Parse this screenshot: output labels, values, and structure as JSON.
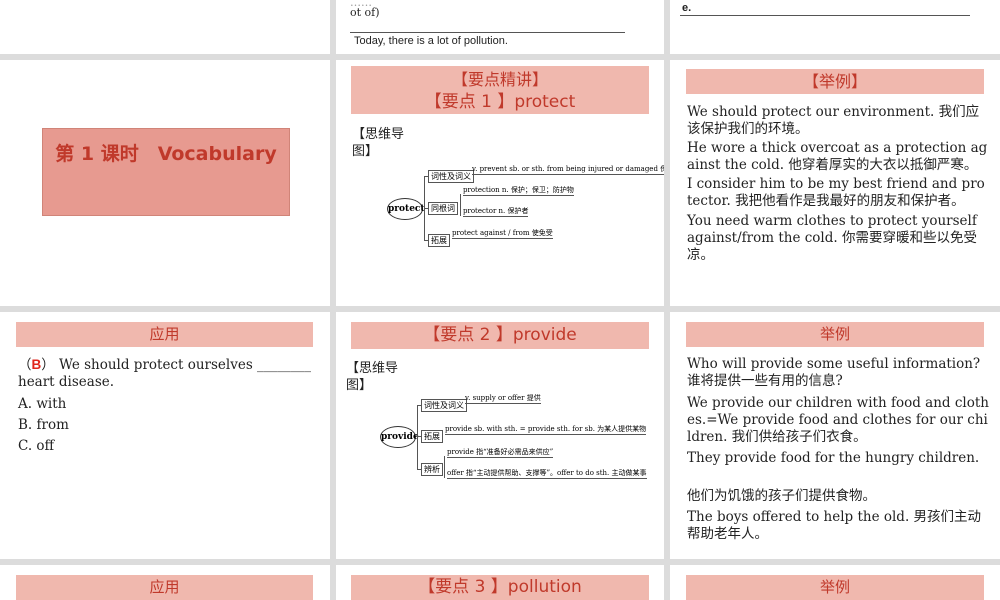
{
  "top": {
    "mid_partial": "ot of)",
    "mid_partial_prefix": "……",
    "mid_answer": "Today, there is a lot of pollution.",
    "right_partial": "e."
  },
  "slide1": {
    "title": "第 1 课时　Vocabulary"
  },
  "slide2": {
    "header1": "【要点精讲】",
    "header2": "【要点 1 】protect",
    "mindmap_label": "【思维导图】",
    "center": "protect",
    "branches": [
      {
        "tag": "词性及词义",
        "text": "v. prevent sb. or sth. from being injured or damaged 保护"
      },
      {
        "tag": "同根词",
        "text": "protection n. 保护；保卫；防护物"
      },
      {
        "tag": "",
        "text": "protector n. 保护者"
      },
      {
        "tag": "拓展",
        "text": "protect against / from 使免受"
      }
    ]
  },
  "slide3": {
    "header": "【举例】",
    "examples": [
      "We should protect our environment. 我们应该保护我们的环境。",
      "He wore a thick overcoat as a protection against the cold. 他穿着厚实的大衣以抵御严寒。",
      "I consider him to be my best friend and protector. 我把他看作是我最好的朋友和保护者。",
      "You need warm clothes to protect yourself against/from the cold. 你需要穿暖和些以免受凉。"
    ]
  },
  "slide4": {
    "header": "应用",
    "answer": "B",
    "question": "We should protect ourselves ________ heart disease.",
    "options": [
      "A. with",
      "B. from",
      "C. off"
    ]
  },
  "slide5": {
    "header": "【要点 2 】provide",
    "mindmap_label": "【思维导图】",
    "center": "provide",
    "branches": [
      {
        "tag": "词性及词义",
        "text": "v. supply or offer 提供"
      },
      {
        "tag": "拓展",
        "text": "provide sb. with sth. = provide sth. for sb. 为某人提供某物"
      },
      {
        "tag": "辨析",
        "text": "provide 指“准备好必需品来供应”"
      },
      {
        "tag": "",
        "text": "offer 指“主动提供帮助、支撑等”。offer to do sth. 主动做某事"
      }
    ]
  },
  "slide6": {
    "header": "举例",
    "examples": [
      "Who will provide some useful information? 谁将提供一些有用的信息?",
      "We provide our children with food and clothes.=We provide food and clothes for our children. 我们供给孩子们衣食。",
      "They provide food for the hungry children.",
      "他们为饥饿的孩子们提供食物。",
      "The boys offered to help the old. 男孩们主动帮助老年人。"
    ]
  },
  "bottom": {
    "left_header": "应用",
    "mid_header": "【要点 3 】pollution",
    "right_header": "举例"
  },
  "colors": {
    "band": "#f0b8ae",
    "title_bg": "#e79a90",
    "accent_red": "#e0261c"
  }
}
